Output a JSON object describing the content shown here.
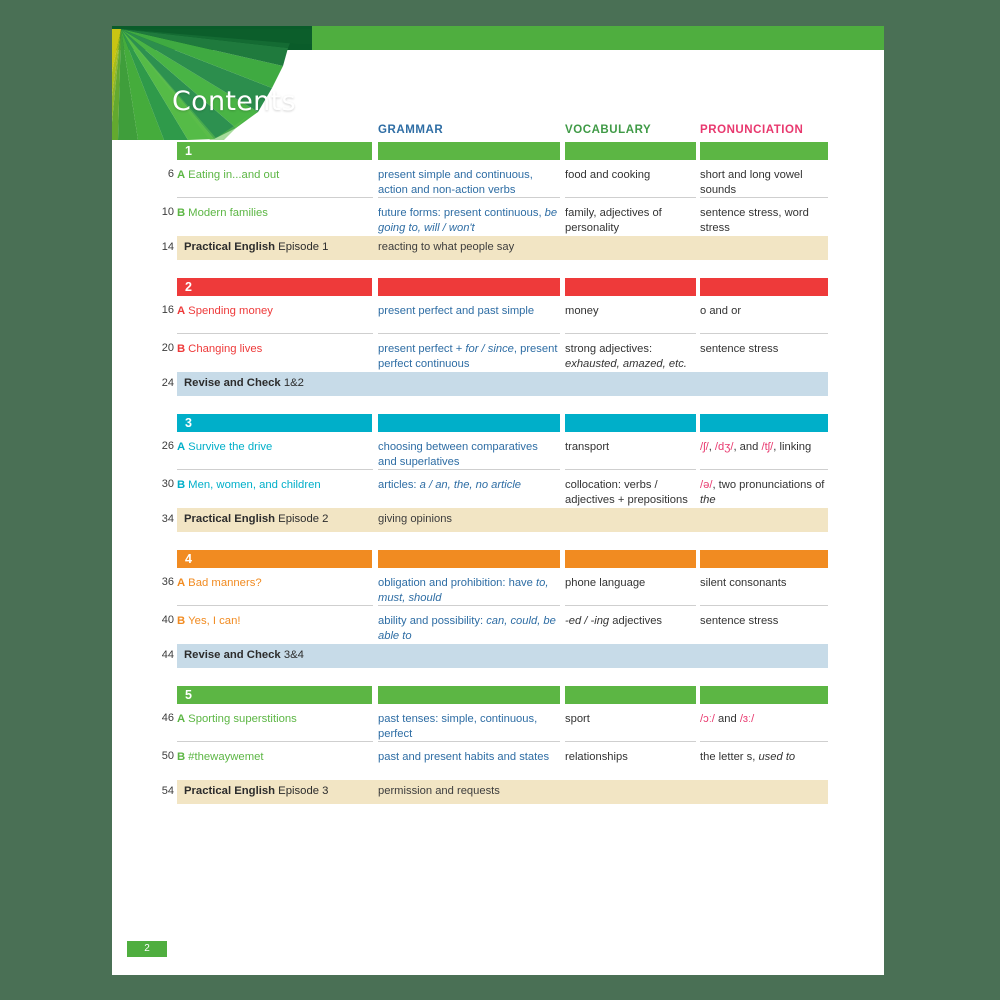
{
  "header": {
    "title": "Contents",
    "columns": {
      "grammar": "GRAMMAR",
      "vocabulary": "VOCABULARY",
      "pronunciation": "PRONUNCIATION"
    },
    "colors": {
      "grammar": "#2e6da4",
      "vocabulary": "#3f9a46",
      "pronunciation": "#e8386e",
      "top_bar": "#4fae3f",
      "page_background": "#4a7055"
    }
  },
  "units": [
    {
      "number": "1",
      "color": "#5cb644",
      "lessons": [
        {
          "page": "6",
          "letter": "A",
          "title": "Eating in...and out",
          "grammar": "present simple and continuous, action and non-action verbs",
          "vocabulary": "food and cooking",
          "pronunciation": "short and long vowel sounds"
        },
        {
          "page": "10",
          "letter": "B",
          "title": "Modern families",
          "grammar": "future forms: present continuous, be going to, will / won't",
          "vocabulary": "family, adjectives of personality",
          "pronunciation": "sentence stress, word stress"
        }
      ],
      "practical_english": {
        "page": "14",
        "label_bold": "Practical English",
        "label_rest": " Episode 1",
        "description": "reacting to what people say"
      }
    },
    {
      "number": "2",
      "color": "#ee3a3a",
      "lessons": [
        {
          "page": "16",
          "letter": "A",
          "title": "Spending money",
          "grammar": "present perfect and past simple",
          "vocabulary": "money",
          "pronunciation": "o and or"
        },
        {
          "page": "20",
          "letter": "B",
          "title": "Changing lives",
          "grammar": "present perfect + for / since, present perfect continuous",
          "vocabulary": "strong adjectives: exhausted, amazed, etc.",
          "pronunciation": "sentence stress"
        }
      ],
      "revise_and_check": {
        "page": "24",
        "label_bold": "Revise and Check",
        "label_rest": " 1&2"
      }
    },
    {
      "number": "3",
      "color": "#00afc9",
      "lessons": [
        {
          "page": "26",
          "letter": "A",
          "title": "Survive the drive",
          "grammar": "choosing between comparatives and superlatives",
          "vocabulary": "transport",
          "pronunciation": "/ʃ/, /dʒ/, and /tʃ/, linking"
        },
        {
          "page": "30",
          "letter": "B",
          "title": "Men, women, and children",
          "grammar": "articles: a / an, the, no article",
          "vocabulary": "collocation: verbs / adjectives + prepositions",
          "pronunciation": "/ə/, two pronunciations of the"
        }
      ],
      "practical_english": {
        "page": "34",
        "label_bold": "Practical English",
        "label_rest": " Episode 2",
        "description": "giving opinions"
      }
    },
    {
      "number": "4",
      "color": "#f18b21",
      "lessons": [
        {
          "page": "36",
          "letter": "A",
          "title": "Bad manners?",
          "grammar": "obligation and prohibition: have to, must, should",
          "vocabulary": "phone language",
          "pronunciation": "silent consonants"
        },
        {
          "page": "40",
          "letter": "B",
          "title": "Yes, I can!",
          "grammar": "ability and possibility: can, could, be able to",
          "vocabulary": "-ed / -ing adjectives",
          "pronunciation": "sentence stress"
        }
      ],
      "revise_and_check": {
        "page": "44",
        "label_bold": "Revise and Check",
        "label_rest": " 3&4"
      }
    },
    {
      "number": "5",
      "color": "#5cb644",
      "lessons": [
        {
          "page": "46",
          "letter": "A",
          "title": "Sporting superstitions",
          "grammar": "past tenses: simple, continuous, perfect",
          "vocabulary": "sport",
          "pronunciation": "/ɔː/ and /ɜː/"
        },
        {
          "page": "50",
          "letter": "B",
          "title": "#thewaywemet",
          "grammar": "past and present habits and states",
          "vocabulary": "relationships",
          "pronunciation": "the letter s, used to"
        }
      ],
      "practical_english": {
        "page": "54",
        "label_bold": "Practical English",
        "label_rest": " Episode 3",
        "description": "permission and requests"
      }
    }
  ],
  "footer": {
    "page_number": "2"
  }
}
